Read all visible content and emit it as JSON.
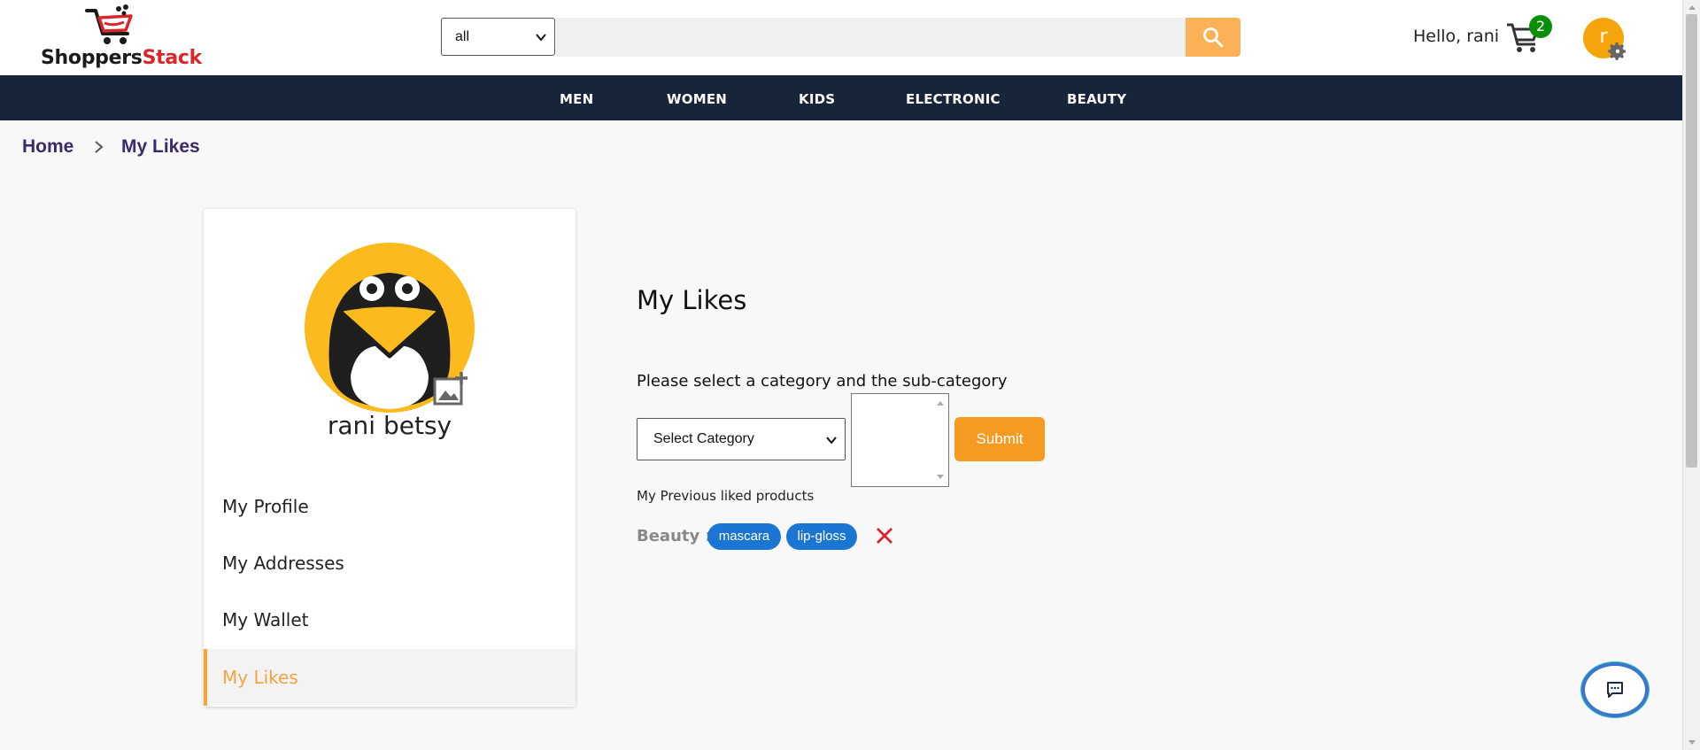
{
  "header": {
    "logo_part1": "Shoppers",
    "logo_part2": "Stack",
    "search": {
      "category_value": "all",
      "placeholder": ""
    },
    "greeting": "Hello, rani",
    "cart_count": "2",
    "avatar_initial": "r"
  },
  "nav": {
    "items": [
      "MEN",
      "WOMEN",
      "KIDS",
      "ELECTRONIC",
      "BEAUTY"
    ]
  },
  "breadcrumb": {
    "home": "Home",
    "current": "My Likes"
  },
  "sidebar": {
    "name": "rani betsy",
    "menu": [
      "My Profile",
      "My Addresses",
      "My Wallet",
      "My Likes"
    ],
    "active_item": "My Likes"
  },
  "main": {
    "title": "My Likes",
    "instruction": "Please select a category and the sub-category",
    "category_select": "Select Category",
    "submit_label": "Submit",
    "previous_liked_heading": "My Previous liked products",
    "liked": [
      {
        "category": "Beauty :",
        "tags": [
          "mascara",
          "lip-gloss"
        ]
      }
    ]
  },
  "colors": {
    "nav_bg": "#17243a",
    "accent_orange": "#f59b22",
    "tag_blue": "#1a76d2",
    "cart_badge": "#0a8f08",
    "remove_red": "#d8262c"
  },
  "icons": [
    "cart-logo-icon",
    "search-icon",
    "cart-icon",
    "gear-icon",
    "add-photo-icon",
    "chevron-right-icon",
    "close-icon",
    "chat-icon"
  ]
}
